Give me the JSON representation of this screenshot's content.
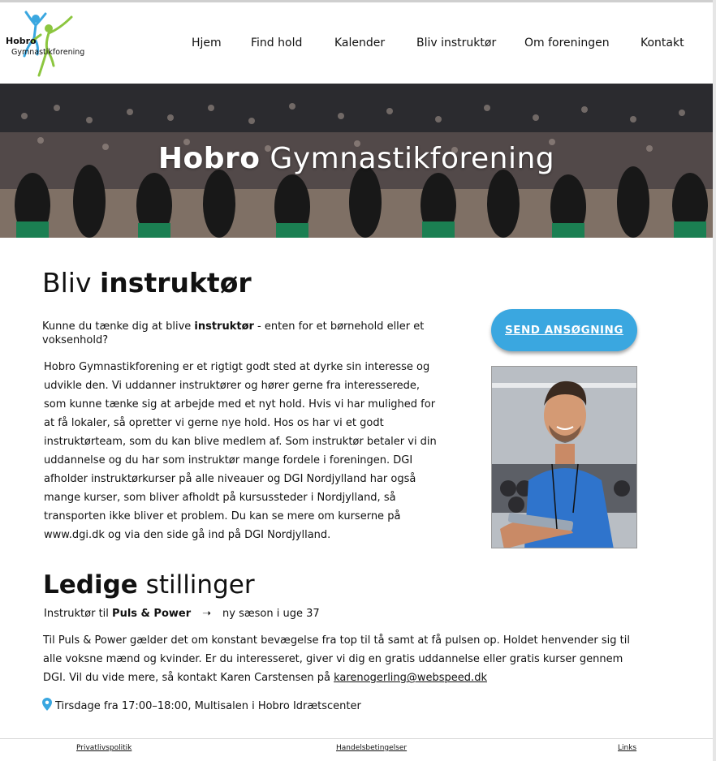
{
  "logo": {
    "line1": "Hobro",
    "line2": "Gymnastikforening"
  },
  "nav": {
    "items": [
      "Hjem",
      "Find hold",
      "Kalender",
      "Bliv instruktør",
      "Om foreningen",
      "Kontakt"
    ]
  },
  "hero": {
    "title_bold": "Hobro",
    "title_rest": " Gymnastikforening"
  },
  "page": {
    "heading_normal": "Bliv ",
    "heading_bold": "instruktør",
    "intro_pre": "Kunne du tænke dig at blive ",
    "intro_bold": "instruktør",
    "intro_post": " - enten for et børnehold eller et voksenhold?",
    "body": "Hobro Gymnastikforening er et rigtigt godt sted at dyrke sin interesse og udvikle den. Vi uddanner instruktører og hører gerne fra interesserede, som kunne tænke sig at arbejde med et nyt hold. Hvis vi har mulighed for at få lokaler, så opretter vi gerne nye hold. Hos os har vi et godt instruktørteam, som du kan blive medlem af. Som instruktør betaler vi din uddannelse og du har som instruktør mange fordele i foreningen. DGI afholder instruktørkurser på alle niveauer og DGI Nordjylland har også mange kurser, som bliver afholdt på kursussteder i Nordjylland, så transporten ikke bliver et problem. Du kan se mere om kurserne på www.dgi.dk og via den side gå ind på DGI Nordjylland.",
    "apply_button": "SEND ANSØGNING"
  },
  "jobs": {
    "heading_bold": "Ledige",
    "heading_rest": " stillinger",
    "job_prefix": "Instruktør til ",
    "job_name": "Puls & Power",
    "job_arrow": "➝",
    "job_when": "ny sæson i uge 37",
    "desc": "Til Puls & Power gælder det om konstant bevægelse fra top til tå samt at få pulsen op. Holdet henvender sig til alle voksne mænd og kvinder. Er du interesseret, giver vi dig en gratis uddannelse eller gratis kurser gennem DGI.  Vil du vide mere, så kontakt Karen Carstensen på ",
    "email": "karenogerling@webspeed.dk",
    "location": "Tirsdage fra 17:00–18:00, Multisalen i Hobro Idrætscenter",
    "location_icon": "map-pin-icon"
  },
  "footer": {
    "links": [
      "Privatlivspolitik",
      "Handelsbetingelser",
      "Links"
    ]
  },
  "colors": {
    "accent": "#3aa7e0",
    "pin": "#3aa7e0",
    "logo_green": "#8cc63f",
    "logo_blue": "#3aa7e0"
  }
}
